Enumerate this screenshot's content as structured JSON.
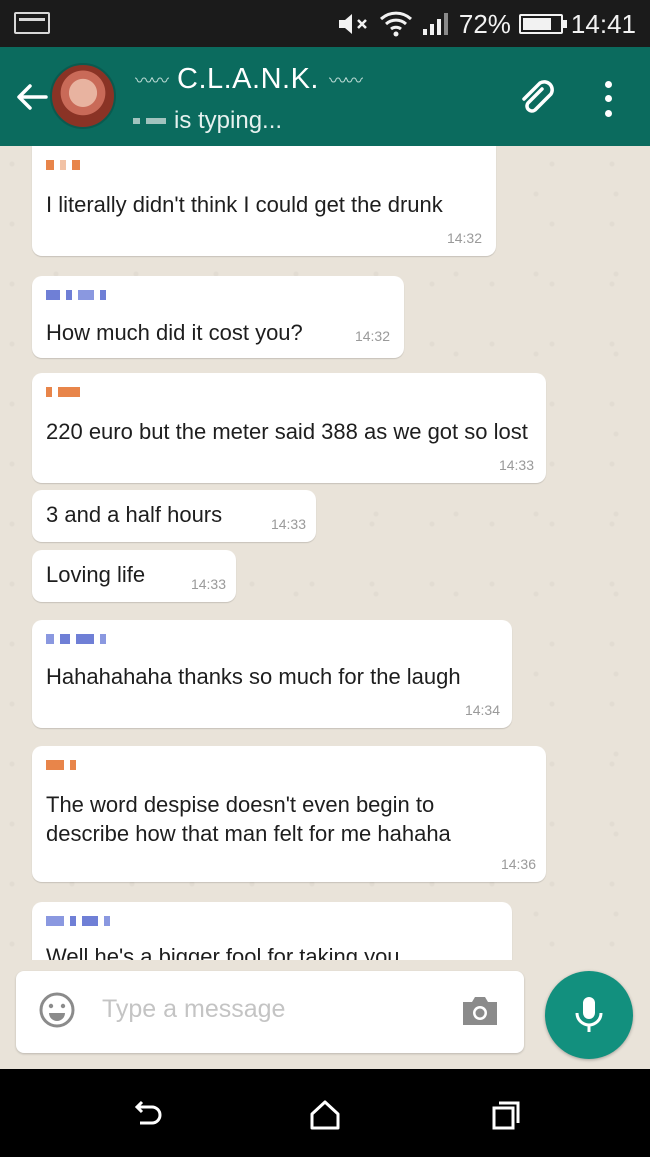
{
  "status_bar": {
    "battery": "72%",
    "time": "14:41",
    "icons": [
      "screenshot-icon",
      "mute-icon",
      "wifi-icon",
      "signal-icon",
      "battery-icon"
    ]
  },
  "header": {
    "title": "C.L.A.N.K.",
    "subtitle": "is typing...",
    "colors": {
      "bar": "#0b6b5e"
    }
  },
  "messages": [
    {
      "text": "I literally didn't think I could get the drunk",
      "time": "14:32",
      "sender_color": "#e8854a"
    },
    {
      "text": "How much did it cost you?",
      "time": "14:32",
      "sender_color": "#6f7fd6"
    },
    {
      "text": "220 euro but the meter said 388 as we got so lost",
      "time": "14:33",
      "sender_color": "#e8854a"
    },
    {
      "text": "3 and a half hours",
      "time": "14:33"
    },
    {
      "text": "Loving life",
      "time": "14:33"
    },
    {
      "text": "Hahahahaha thanks so much for the laugh",
      "time": "14:34",
      "sender_color": "#6f7fd6"
    },
    {
      "text": "The word despise doesn't even begin to describe how that man felt for me hahaha",
      "time": "14:36",
      "sender_color": "#e8854a"
    },
    {
      "text": "Well he's a bigger fool for taking you",
      "time": "",
      "sender_color": "#6f7fd6"
    }
  ],
  "input": {
    "placeholder": "Type a message"
  },
  "accent_colors": {
    "mic": "#12907e"
  }
}
